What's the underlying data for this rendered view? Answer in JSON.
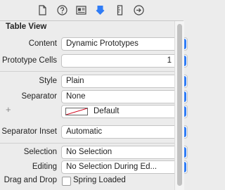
{
  "toolbar": {
    "icons": [
      "file-inspector-icon",
      "quick-help-icon",
      "identity-inspector-icon",
      "attributes-inspector-icon",
      "size-inspector-icon",
      "connections-inspector-icon"
    ],
    "active_color": "#2f7cf6"
  },
  "section": {
    "title": "Table View"
  },
  "rows": {
    "content": {
      "label": "Content",
      "value": "Dynamic Prototypes"
    },
    "prototype_cells": {
      "label": "Prototype Cells",
      "value": "1"
    },
    "style": {
      "label": "Style",
      "value": "Plain"
    },
    "separator": {
      "label": "Separator",
      "value": "None"
    },
    "separator_color": {
      "value": "Default"
    },
    "separator_inset": {
      "label": "Separator Inset",
      "value": "Automatic"
    },
    "selection": {
      "label": "Selection",
      "value": "No Selection"
    },
    "editing": {
      "label": "Editing",
      "value": "No Selection During Ed..."
    },
    "drag_and_drop": {
      "label": "Drag and Drop",
      "checkbox_label": "Spring Loaded",
      "checked": false
    }
  },
  "plus_symbol": "+"
}
